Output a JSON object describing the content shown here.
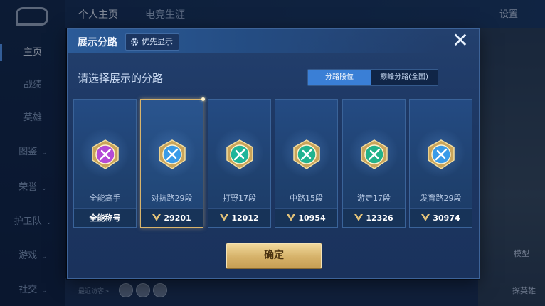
{
  "sidebar": {
    "items": [
      {
        "label": "主页",
        "active": true
      },
      {
        "label": "战绩"
      },
      {
        "label": "英雄"
      },
      {
        "label": "图鉴",
        "chev": true
      },
      {
        "label": "荣誉",
        "chev": true
      },
      {
        "label": "护卫队",
        "chev": true
      },
      {
        "label": "游戏",
        "chev": true
      },
      {
        "label": "社交",
        "chev": true
      }
    ]
  },
  "top_tabs": [
    "个人主页",
    "电竞生涯"
  ],
  "settings_label": "设置",
  "right_panel": {
    "model_label": "模型",
    "explore_label": "探英雄"
  },
  "visitors_label": "最近访客>",
  "modal": {
    "title": "展示分路",
    "priority_button": "优先显示",
    "close_symbol": "✕",
    "subtitle": "请选择展示的分路",
    "segments": [
      "分路段位",
      "巅峰分路(全国)"
    ],
    "confirm_label": "确定",
    "cards": [
      {
        "name": "全能高手",
        "foot": "全能称号",
        "emblem": "allround-emblem-icon",
        "color": "#b44ad6",
        "selected": false,
        "show_icon": false
      },
      {
        "name": "对抗路29段",
        "foot": "29201",
        "emblem": "clash-lane-emblem-icon",
        "color": "#3a9be8",
        "selected": true,
        "show_icon": true
      },
      {
        "name": "打野17段",
        "foot": "12012",
        "emblem": "jungle-emblem-icon",
        "color": "#1fb59a",
        "selected": false,
        "show_icon": true
      },
      {
        "name": "中路15段",
        "foot": "10954",
        "emblem": "mid-lane-emblem-icon",
        "color": "#21b38f",
        "selected": false,
        "show_icon": true
      },
      {
        "name": "游走17段",
        "foot": "12326",
        "emblem": "roam-emblem-icon",
        "color": "#22b28a",
        "selected": false,
        "show_icon": true
      },
      {
        "name": "发育路29段",
        "foot": "30974",
        "emblem": "farm-lane-emblem-icon",
        "color": "#3a9be8",
        "selected": false,
        "show_icon": true
      }
    ]
  }
}
